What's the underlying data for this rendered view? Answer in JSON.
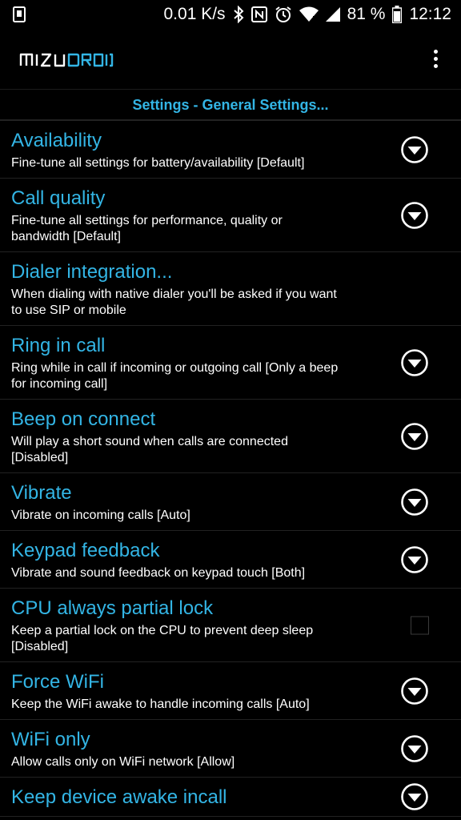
{
  "status_bar": {
    "speed": "0.01 K/s",
    "battery": "81 %",
    "time": "12:12"
  },
  "app_bar": {
    "logo_text": "MIZUDROID"
  },
  "section_header": "Settings - General Settings...",
  "colors": {
    "accent": "#33b5e5",
    "background": "#000000",
    "divider": "#222222"
  },
  "items": [
    {
      "title": "Availability",
      "summary": "Fine-tune all settings for battery/availability [Default]",
      "widget": "dropdown"
    },
    {
      "title": "Call quality",
      "summary": "Fine-tune all settings for performance, quality or bandwidth [Default]",
      "widget": "dropdown"
    },
    {
      "title": "Dialer integration...",
      "summary": "When dialing with native dialer you'll be asked if you want to use SIP or mobile",
      "widget": "none"
    },
    {
      "title": "Ring in call",
      "summary": "Ring while in call if incoming or outgoing call [Only a beep for incoming call]",
      "widget": "dropdown"
    },
    {
      "title": "Beep on connect",
      "summary": "Will play a short sound when calls are connected [Disabled]",
      "widget": "dropdown"
    },
    {
      "title": "Vibrate",
      "summary": "Vibrate on incoming calls [Auto]",
      "widget": "dropdown"
    },
    {
      "title": "Keypad feedback",
      "summary": "Vibrate and sound feedback on keypad touch [Both]",
      "widget": "dropdown"
    },
    {
      "title": "CPU always partial lock",
      "summary": "Keep a partial lock on the CPU to prevent deep sleep [Disabled]",
      "widget": "checkbox",
      "checked": false
    },
    {
      "title": "Force WiFi",
      "summary": "Keep the WiFi awake to handle incoming calls [Auto]",
      "widget": "dropdown"
    },
    {
      "title": "WiFi only",
      "summary": "Allow calls only on WiFi network [Allow]",
      "widget": "dropdown"
    },
    {
      "title": "Keep device awake incall",
      "summary": "",
      "widget": "dropdown"
    }
  ]
}
